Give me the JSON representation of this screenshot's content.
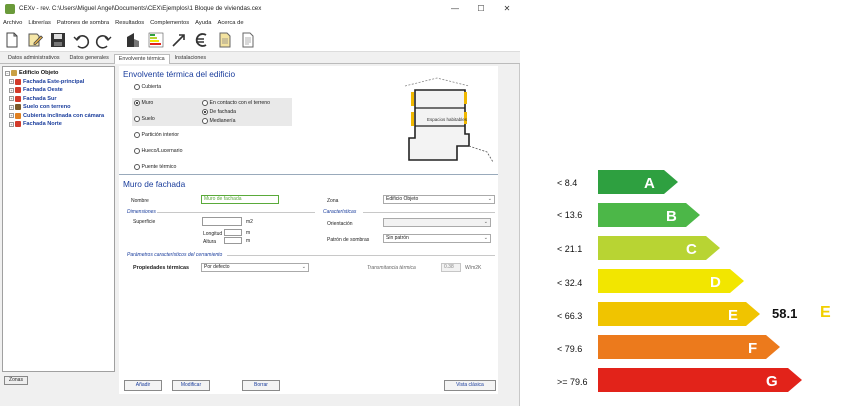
{
  "window": {
    "title": "CEXv - rev. C:\\Users\\Miguel Angel\\Documents\\CEX\\Ejemplos\\1 Bloque de viviendas.cex",
    "minimize": "—",
    "maximize": "☐",
    "close": "✕"
  },
  "menu": [
    "Archivo",
    "Librerías",
    "Patrones de sombra",
    "Resultados",
    "Complementos",
    "Ayuda",
    "Acerca de"
  ],
  "toolbar": {
    "buttons": [
      "new-file-icon",
      "edit-icon",
      "save-icon",
      "undo-icon",
      "redo-icon",
      "building-icon",
      "energy-label-icon",
      "arrow-icon",
      "euro-icon",
      "document-icon",
      "report-icon"
    ]
  },
  "tabs": [
    "Datos administrativos",
    "Datos generales",
    "Envolvente térmica",
    "Instalaciones"
  ],
  "tree": {
    "root": "Edificio Objeto",
    "items": [
      {
        "label": "Fachada Este-principal",
        "color": "#d23a2a"
      },
      {
        "label": "Fachada Oeste",
        "color": "#d23a2a"
      },
      {
        "label": "Fachada Sur",
        "color": "#d23a2a"
      },
      {
        "label": "Suelo con terreno",
        "color": "#7a5a2a"
      },
      {
        "label": "Cubierta inclinada con cámara",
        "color": "#e08020"
      },
      {
        "label": "Fachada Norte",
        "color": "#d23a2a"
      }
    ],
    "button": "Zonas"
  },
  "envelope": {
    "title": "Envolvente térmica del edificio",
    "options": {
      "cubierta": "Cubierta",
      "muro": "Muro",
      "suelo": "Suelo",
      "particion": "Partición interior",
      "hueco": "Hueco/Lucernario",
      "puente": "Puente térmico",
      "contacto": "En contacto con el terreno",
      "fachada": "De fachada",
      "medianera": "Medianería"
    },
    "diagram_label": "Espacios habitables"
  },
  "muro": {
    "title": "Muro de fachada",
    "nombre_label": "Nombre",
    "nombre_value": "Muro de fachada",
    "zona_label": "Zona",
    "zona_value": "Edificio Objeto",
    "dimensiones_label": "Dimensiones",
    "superficie_label": "Superficie",
    "superficie_unit": "m2",
    "longitud_label": "Longitud",
    "altura_label": "Altura",
    "longitud_unit": "m",
    "altura_unit": "m",
    "caracteristicas_label": "Características",
    "orientacion_label": "Orientación",
    "orientacion_value": "",
    "patron_label": "Patrón de sombras",
    "patron_value": "Sin patrón",
    "parametros_label": "Parámetros característicos del cerramiento",
    "propiedades_label": "Propiedades térmicas",
    "propiedades_value": "Por defecto",
    "transmitancia_label": "Transmitancia térmica",
    "transmitancia_value": "0.38",
    "transmitancia_unit": "W/m2K"
  },
  "footer": {
    "add": "Añadir",
    "modify": "Modificar",
    "delete": "Borrar",
    "view": "Vista clásica"
  },
  "rating": {
    "bands": [
      {
        "label": "< 8.4",
        "letter": "A",
        "color": "#2ea040"
      },
      {
        "label": "< 13.6",
        "letter": "B",
        "color": "#4cb748"
      },
      {
        "label": "< 21.1",
        "letter": "C",
        "color": "#b8d433"
      },
      {
        "label": "< 32.4",
        "letter": "D",
        "color": "#f2e600"
      },
      {
        "label": "< 66.3",
        "letter": "E",
        "color": "#f0c400"
      },
      {
        "label": "< 79.6",
        "letter": "F",
        "color": "#ec7a1c"
      },
      {
        "label": ">= 79.6",
        "letter": "G",
        "color": "#e2231a"
      }
    ],
    "value": "58.1",
    "class": "E"
  }
}
